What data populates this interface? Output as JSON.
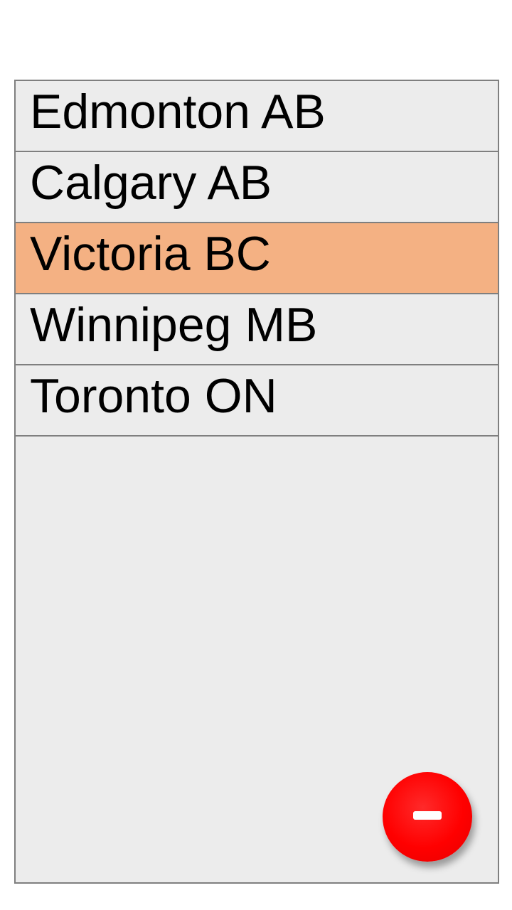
{
  "list": {
    "selected_index": 2,
    "items": [
      {
        "label": "Edmonton AB"
      },
      {
        "label": "Calgary AB"
      },
      {
        "label": "Victoria BC"
      },
      {
        "label": "Winnipeg MB"
      },
      {
        "label": "Toronto ON"
      }
    ]
  },
  "fab": {
    "icon": "minus-icon",
    "color": "#ff0000"
  },
  "colors": {
    "selected_row": "#f4b183",
    "list_background": "#ececec",
    "border": "#7f7f7f"
  }
}
